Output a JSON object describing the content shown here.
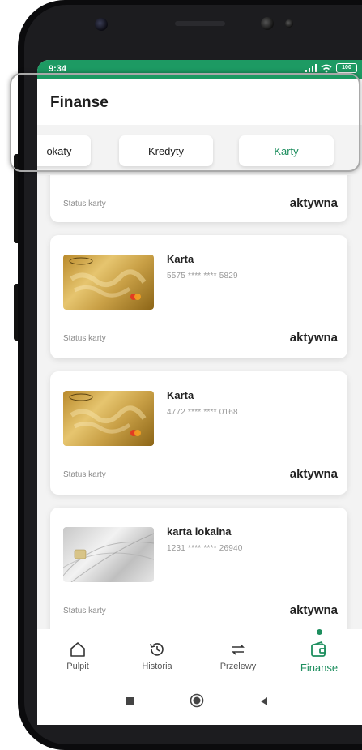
{
  "statusbar": {
    "time": "9:34",
    "battery": "100"
  },
  "appbar": {
    "title": "Finanse"
  },
  "tabs": [
    {
      "label": "okaty",
      "active": false
    },
    {
      "label": "Kredyty",
      "active": false
    },
    {
      "label": "Karty",
      "active": true
    }
  ],
  "cards": [
    {
      "name": "",
      "number": "",
      "status_label": "Status karty",
      "status_value": "aktywna"
    },
    {
      "name": "Karta",
      "number": "5575 **** **** 5829",
      "status_label": "Status karty",
      "status_value": "aktywna",
      "image": "gold-card"
    },
    {
      "name": "Karta",
      "number": "4772 **** **** 0168",
      "status_label": "Status karty",
      "status_value": "aktywna",
      "image": "gold-card"
    },
    {
      "name": "karta lokalna",
      "number": "1231 **** **** 26940",
      "status_label": "Status karty",
      "status_value": "aktywna",
      "image": "gray-card"
    }
  ],
  "bottom_nav": [
    {
      "label": "Pulpit",
      "icon": "home-icon",
      "active": false
    },
    {
      "label": "Historia",
      "icon": "history-icon",
      "active": false
    },
    {
      "label": "Przelewy",
      "icon": "transfer-icon",
      "active": false
    },
    {
      "label": "Finanse",
      "icon": "wallet-icon",
      "active": true
    }
  ],
  "colors": {
    "brand": "#1d9a63",
    "accent": "#1d8e5e"
  }
}
